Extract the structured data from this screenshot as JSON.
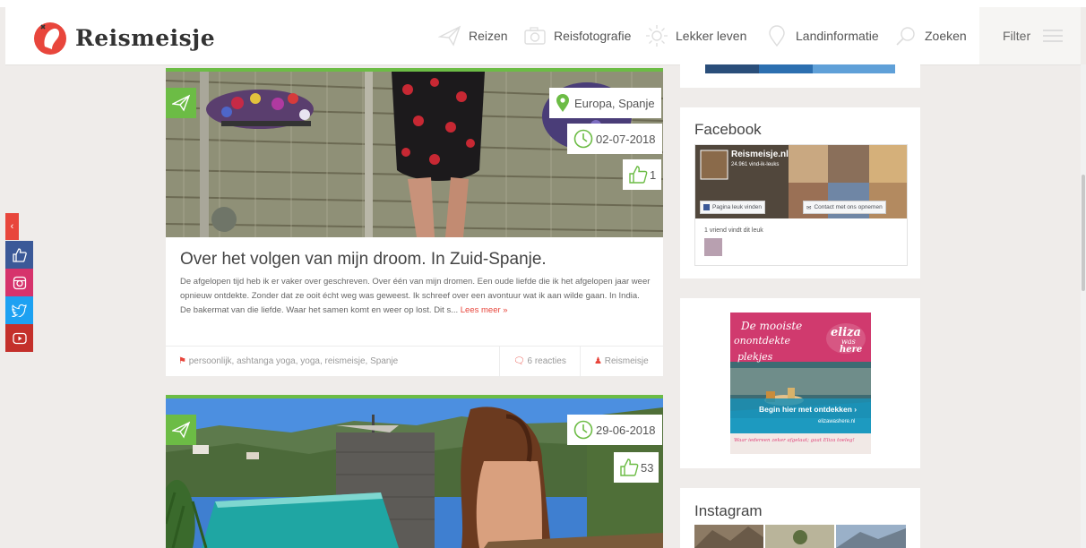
{
  "brand": {
    "name": "Reismeisje",
    "accent": "#e8463c",
    "green": "#6cbc45"
  },
  "nav": {
    "items": [
      {
        "label": "Reizen",
        "icon": "paper-plane-icon"
      },
      {
        "label": "Reisfotografie",
        "icon": "camera-icon"
      },
      {
        "label": "Lekker leven",
        "icon": "sun-icon"
      },
      {
        "label": "Landinformatie",
        "icon": "map-pin-icon"
      },
      {
        "label": "Zoeken",
        "icon": "search-icon"
      }
    ],
    "filter_label": "Filter"
  },
  "social": {
    "toggle": "‹",
    "items": [
      {
        "icon": "thumbs-up-icon",
        "color": "#3b5998"
      },
      {
        "icon": "instagram-icon",
        "color": "#d6336c"
      },
      {
        "icon": "twitter-icon",
        "color": "#1da1f2"
      },
      {
        "icon": "youtube-icon",
        "color": "#c4302b"
      }
    ]
  },
  "posts": [
    {
      "location": "Europa, Spanje",
      "date": "02-07-2018",
      "likes": "1",
      "title": "Over het volgen van mijn droom. In Zuid-Spanje.",
      "excerpt": "De afgelopen tijd heb ik er vaker over geschreven. Over één van mijn dromen. Een oude liefde die ik het afgelopen jaar weer opnieuw ontdekte. Zonder dat ze ooit écht weg was geweest. Ik schreef over een avontuur wat ik aan wilde gaan. In India. De bakermat van die liefde. Waar het samen komt en weer op lost. Dit s...",
      "read_more": "Lees meer »",
      "tags": "persoonlijk, ashtanga yoga, yoga, reismeisje, Spanje",
      "comments": "6 reacties",
      "author": "Reismeisje"
    },
    {
      "date": "29-06-2018",
      "likes": "53"
    }
  ],
  "sidebar": {
    "facebook": {
      "title": "Facebook",
      "page_name": "Reismeisje.nl",
      "likes_count": "24.961 vind-ik-leuks",
      "like_button": "Pagina leuk vinden",
      "contact_button": "Contact met ons opnemen",
      "friends_text": "1 vriend vindt dit leuk"
    },
    "ad": {
      "line1": "De mooiste",
      "line2": "onontdekte",
      "line3": "plekjes",
      "brand_line1": "eliza",
      "brand_line2": "was",
      "brand_line3": "here",
      "cta": "Begin hier met ontdekken ›",
      "url": "elizawashere.nl",
      "slogan": "Waar iedereen zeker afgelaat; gaat Eliza toeleg!"
    },
    "instagram": {
      "title": "Instagram"
    }
  }
}
